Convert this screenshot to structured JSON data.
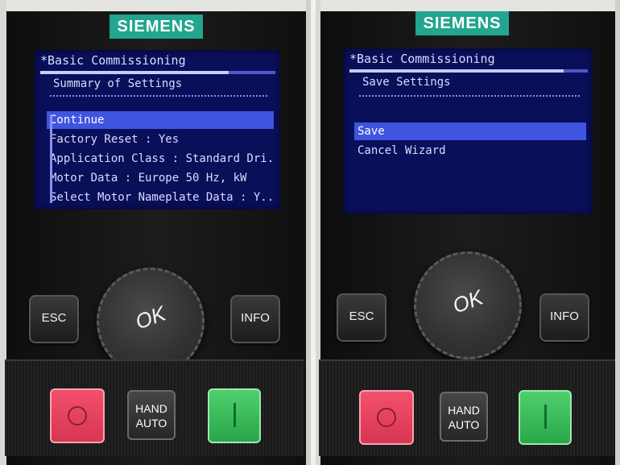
{
  "left_panel": {
    "brand": "SIEMENS",
    "screen": {
      "title": "*Basic Commissioning",
      "progress": 0.8,
      "subtitle": "Summary of Settings",
      "items": [
        {
          "label": "Continue",
          "selected": true
        },
        {
          "label": "Factory Reset : Yes",
          "selected": false
        },
        {
          "label": "Application Class : Standard Dri..",
          "selected": false
        },
        {
          "label": "Motor Data : Europe 50 Hz, kW",
          "selected": false
        },
        {
          "label": "Select Motor Nameplate Data : Y..",
          "selected": false
        }
      ]
    },
    "buttons": {
      "esc": "ESC",
      "ok": "OK",
      "info": "INFO",
      "hand": "HAND",
      "auto": "AUTO"
    }
  },
  "right_panel": {
    "brand": "SIEMENS",
    "screen": {
      "title": "*Basic Commissioning",
      "progress": 0.9,
      "subtitle": "Save Settings",
      "items": [
        {
          "label": "Save",
          "selected": true
        },
        {
          "label": "Cancel Wizard",
          "selected": false
        }
      ]
    },
    "buttons": {
      "esc": "ESC",
      "ok": "OK",
      "info": "INFO",
      "hand": "HAND",
      "auto": "AUTO"
    }
  },
  "colors": {
    "screen_bg": "#0a0f5a",
    "highlight": "#3f55e0",
    "brand": "#23a58f",
    "off_button": "#e0405c",
    "on_button": "#3bbd5c"
  }
}
